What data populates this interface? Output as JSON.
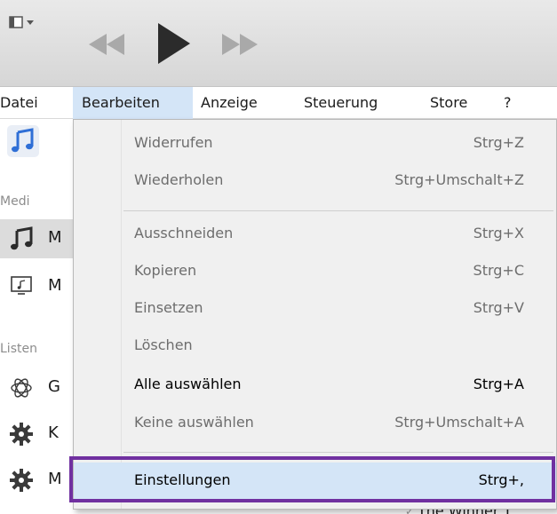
{
  "colors": {
    "menu_highlight": "#d4e5f7",
    "annotation_border": "#7030a0",
    "enabled_text": "#000000",
    "disabled_text": "#6d6d6d"
  },
  "toolbar": {
    "icons": [
      "sidebar-toggle-icon",
      "rewind-icon",
      "play-icon",
      "fast-forward-icon"
    ]
  },
  "menubar": {
    "items": [
      {
        "label": "Datei"
      },
      {
        "label": "Bearbeiten",
        "active": true
      },
      {
        "label": "Anzeige"
      },
      {
        "label": "Steuerung"
      },
      {
        "label": "Store"
      },
      {
        "label": "?"
      }
    ]
  },
  "sidebar": {
    "section_media": "Medi",
    "section_lists": "Listen",
    "rows": [
      {
        "icon": "music-note-icon",
        "label": "M"
      },
      {
        "icon": "monitor-icon",
        "label": "M"
      },
      {
        "icon": "genius-atom-icon",
        "label": "G"
      },
      {
        "icon": "gear-icon",
        "label": "K"
      },
      {
        "icon": "gear-icon",
        "label": "M"
      }
    ]
  },
  "edit_menu": {
    "items": [
      {
        "label": "Widerrufen",
        "shortcut": "Strg+Z",
        "enabled": false
      },
      {
        "label": "Wiederholen",
        "shortcut": "Strg+Umschalt+Z",
        "enabled": false
      },
      {
        "label": "Ausschneiden",
        "shortcut": "Strg+X",
        "enabled": false
      },
      {
        "label": "Kopieren",
        "shortcut": "Strg+C",
        "enabled": false
      },
      {
        "label": "Einsetzen",
        "shortcut": "Strg+V",
        "enabled": false
      },
      {
        "label": "Löschen",
        "shortcut": "",
        "enabled": false
      },
      {
        "label": "Alle auswählen",
        "shortcut": "Strg+A",
        "enabled": true
      },
      {
        "label": "Keine auswählen",
        "shortcut": "Strg+Umschalt+A",
        "enabled": false
      },
      {
        "label": "Einstellungen",
        "shortcut": "Strg+,",
        "enabled": true,
        "highlighted": true
      }
    ]
  },
  "background_list": {
    "partial_title": "The Winner T"
  }
}
